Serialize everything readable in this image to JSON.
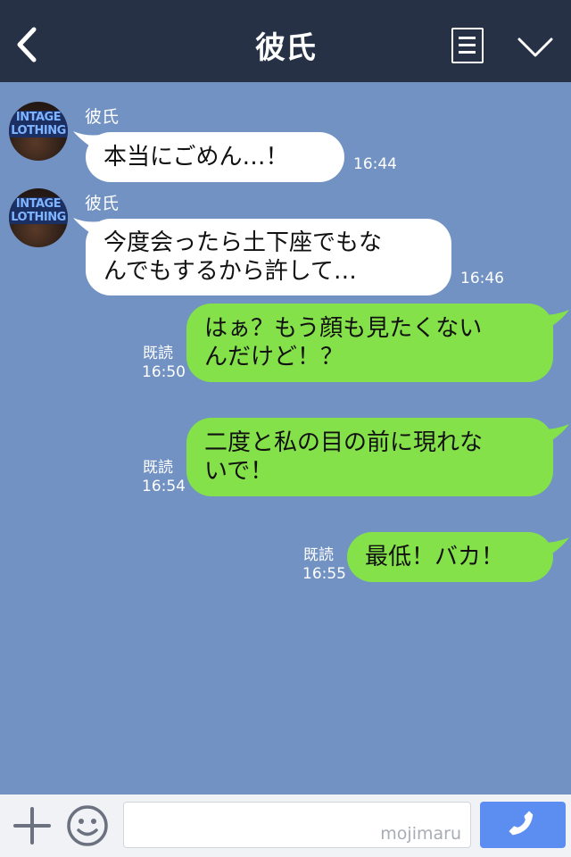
{
  "header": {
    "title": "彼氏",
    "back_icon": "chevron-left-icon",
    "menu_icon": "menu-icon",
    "dropdown_icon": "chevron-down-icon"
  },
  "contact": {
    "name": "彼氏",
    "avatar_sign_line1": "INTAGE",
    "avatar_sign_line2": "LOTHING"
  },
  "messages": [
    {
      "direction": "incoming",
      "sender": "彼氏",
      "lines": [
        "本当にごめん…！"
      ],
      "time": "16:44"
    },
    {
      "direction": "incoming",
      "sender": "彼氏",
      "lines": [
        "今度会ったら土下座でもな",
        "んでもするから許して…"
      ],
      "time": "16:46"
    },
    {
      "direction": "outgoing",
      "read_label": "既読",
      "lines": [
        "はぁ？もう顔も見たくない",
        "んだけど！？"
      ],
      "time": "16:50"
    },
    {
      "direction": "outgoing",
      "read_label": "既読",
      "lines": [
        "二度と私の目の前に現れな",
        "いで！"
      ],
      "time": "16:54"
    },
    {
      "direction": "outgoing",
      "read_label": "既読",
      "lines": [
        "最低！バカ！"
      ],
      "time": "16:55"
    }
  ],
  "footer": {
    "input_value": "",
    "watermark": "mojimaru",
    "plus_icon": "plus-icon",
    "emoji_icon": "smiley-icon",
    "send_icon": "phone-icon"
  },
  "colors": {
    "header_bg": "#263146",
    "chat_bg": "#7192c2",
    "incoming_bubble": "#ffffff",
    "outgoing_bubble": "#84e14a",
    "send_button": "#5b8ef0"
  }
}
